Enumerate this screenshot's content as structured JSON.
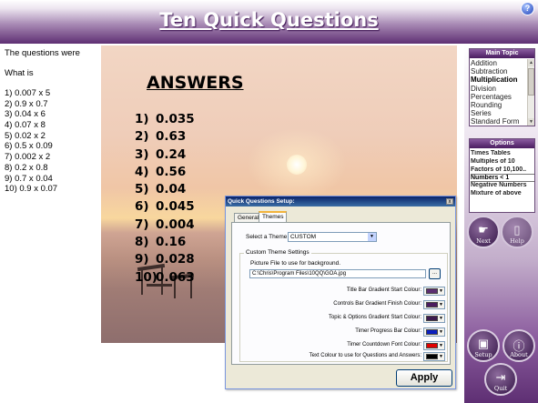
{
  "title_bar": {
    "title": "Ten Quick Questions",
    "help_icon": "?"
  },
  "questions": {
    "intro": "The questions were",
    "what_is": "What is",
    "items": [
      "1) 0.007 x 5",
      "2) 0.9 x 0.7",
      "3) 0.04 x 6",
      "4) 0.07 x 8",
      "5) 0.02 x 2",
      "6) 0.5 x 0.09",
      "7) 0.002 x 2",
      "8) 0.2 x 0.8",
      "9) 0.7 x 0.04",
      "10) 0.9 x 0.07"
    ]
  },
  "answers": {
    "title": "ANSWERS",
    "items": [
      {
        "num": "1)",
        "value": "0.035"
      },
      {
        "num": "2)",
        "value": "0.63"
      },
      {
        "num": "3)",
        "value": "0.24"
      },
      {
        "num": "4)",
        "value": "0.56"
      },
      {
        "num": "5)",
        "value": "0.04"
      },
      {
        "num": "6)",
        "value": "0.045"
      },
      {
        "num": "7)",
        "value": "0.004"
      },
      {
        "num": "8)",
        "value": "0.16"
      },
      {
        "num": "9)",
        "value": "0.028"
      },
      {
        "num": "10)",
        "value": "0.063"
      }
    ]
  },
  "sidebar": {
    "main_topic": {
      "header": "Main Topic",
      "items": [
        "Addition",
        "Subtraction",
        "Multiplication",
        "Division",
        "Percentages",
        "Rounding",
        "Series",
        "Standard Form"
      ],
      "selected": "Multiplication"
    },
    "options": {
      "header": "Options",
      "items": [
        "Times Tables",
        "Multiples of 10",
        "Factors of 10,100..",
        "Numbers < 1",
        "Negative Numbers",
        "Mixture of above"
      ],
      "selected": "Numbers < 1"
    },
    "buttons": {
      "next": "Next",
      "help": "Help",
      "setup": "Setup",
      "about": "About",
      "quit": "Quit"
    }
  },
  "dialog": {
    "title": "Quick Questions Setup:",
    "close": "x",
    "tabs": [
      "General",
      "Themes"
    ],
    "active_tab": "Themes",
    "select_theme_label": "Select a Theme",
    "theme_value": "CUSTOM",
    "group_title": "Custom Theme Settings",
    "picture_label": "Picture File to use for background.",
    "picture_path": "C:\\Chris\\Program Files\\10QQ\\GOA.jpg",
    "browse": "...",
    "colour_settings": [
      {
        "label": "Title Bar Gradient Start Colour:",
        "color": "#5b2d70"
      },
      {
        "label": "Controls Bar Gradient Finish Colour:",
        "color": "#4a1c60"
      },
      {
        "label": "Topic & Options Gradient Start Colour:",
        "color": "#3c1a4e"
      },
      {
        "label": "Timer Progress Bar Colour:",
        "color": "#0b1fbf"
      },
      {
        "label": "Timer Countdown Font Colour:",
        "color": "#e00000"
      },
      {
        "label": "Text Colour to use for Questions and Answers:",
        "color": "#000000"
      }
    ],
    "apply": "Apply"
  }
}
